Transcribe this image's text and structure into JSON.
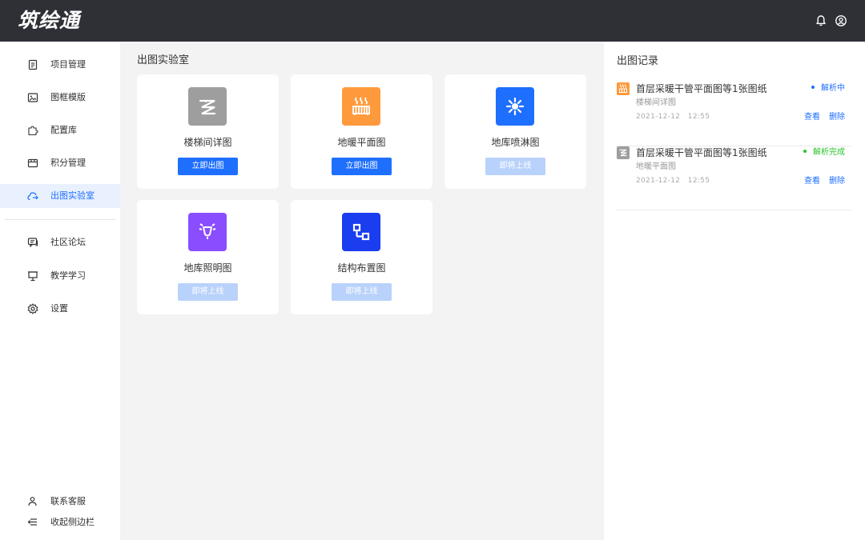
{
  "app": {
    "logo_text": "筑绘通"
  },
  "header": {
    "bell_icon": "bell-icon",
    "user_icon": "user-circle-icon"
  },
  "sidebar": {
    "items": [
      {
        "label": "项目管理",
        "icon": "document-list-icon"
      },
      {
        "label": "图框模版",
        "icon": "frame-icon"
      },
      {
        "label": "配置库",
        "icon": "puzzle-icon"
      },
      {
        "label": "积分管理",
        "icon": "points-icon"
      },
      {
        "label": "出图实验室",
        "icon": "export-icon",
        "active": true
      }
    ],
    "items2": [
      {
        "label": "社区论坛",
        "icon": "chat-icon"
      },
      {
        "label": "教学学习",
        "icon": "presentation-icon"
      },
      {
        "label": "设置",
        "icon": "gear-icon"
      }
    ],
    "bottom": [
      {
        "label": "联系客服",
        "icon": "person-icon"
      },
      {
        "label": "收起侧边栏",
        "icon": "collapse-icon"
      }
    ],
    "active_color": "#1f6fff"
  },
  "main": {
    "title": "出图实验室",
    "cards": [
      {
        "title": "楼梯间详图",
        "button": "立即出图",
        "enabled": true,
        "icon": "stairs-icon",
        "color": "#9e9e9e"
      },
      {
        "title": "地暖平面图",
        "button": "立即出图",
        "enabled": true,
        "icon": "floor-heating-icon",
        "color": "#ff9a3c"
      },
      {
        "title": "地库喷淋图",
        "button": "即将上线",
        "enabled": false,
        "icon": "sprinkler-icon",
        "color": "#1f6fff"
      },
      {
        "title": "地库照明图",
        "button": "即将上线",
        "enabled": false,
        "icon": "lighting-icon",
        "color": "#8a4dff"
      },
      {
        "title": "结构布置图",
        "button": "即将上线",
        "enabled": false,
        "icon": "structure-icon",
        "color": "#1a3df0"
      }
    ]
  },
  "records": {
    "title": "出图记录",
    "items": [
      {
        "title": "首层采暖干管平面图等1张图纸",
        "subtitle": "楼梯间详图",
        "date": "2021-12-12",
        "time": "12:55",
        "status": "解析中",
        "status_color": "#1f6fff",
        "icon": "floor-heating-icon",
        "icon_color": "#ff9a3c",
        "view": "查看",
        "delete": "删除"
      },
      {
        "title": "首层采暖干管平面图等1张图纸",
        "subtitle": "地暖平面图",
        "date": "2021-12-12",
        "time": "12:55",
        "status": "解析完成",
        "status_color": "#2bc52b",
        "icon": "stairs-icon",
        "icon_color": "#9e9e9e",
        "view": "查看",
        "delete": "删除"
      }
    ]
  }
}
